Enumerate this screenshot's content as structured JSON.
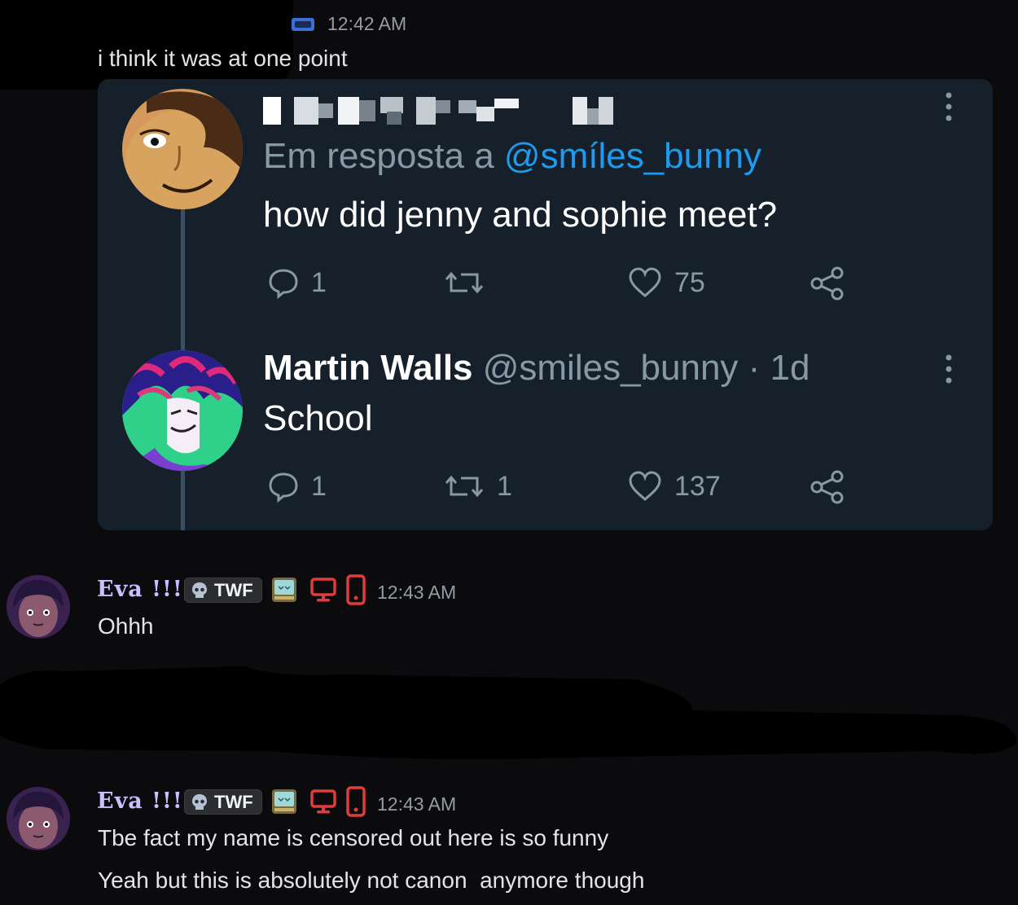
{
  "top_message": {
    "time": "12:42 AM",
    "text": "i think it was at one point"
  },
  "embedded_tweets": {
    "reply_prefix": "Em resposta a ",
    "reply_handle": "@smíles_bunny",
    "tweet1_text": "how did jenny and sophie meet?",
    "tweet1_replies": "1",
    "tweet1_likes": "75",
    "tweet2_author": "Martin Walls",
    "tweet2_handle_time": " @smiles_bunny · 1d",
    "tweet2_text": "School",
    "tweet2_replies": "1",
    "tweet2_retweets": "1",
    "tweet2_likes": "137"
  },
  "message2": {
    "author": "Eva !!!",
    "tag": "TWF",
    "time": "12:43 AM",
    "text": "Ohhh"
  },
  "message3": {
    "author": "Eva !!!",
    "tag": "TWF",
    "time": "12:43 AM",
    "text1": "Tbe fact my name is censored out here is so funny",
    "text2": "Yeah but this is absolutely not canon  anymore though"
  },
  "colors": {
    "background": "#0b0b0d",
    "tweet_bg": "#15202b",
    "mention": "#1d9bf0",
    "device_icon": "#e03c3c"
  }
}
